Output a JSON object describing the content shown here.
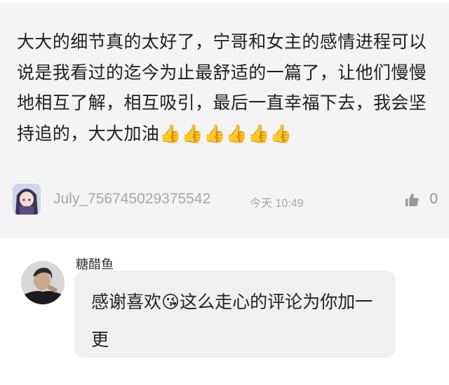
{
  "comment": {
    "text": "大大的细节真的太好了，宁哥和女主的感情进程可以说是我看过的迄今为止最舒适的一篇了，让他们慢慢地相互了解，相互吸引，最后一直幸福下去，我会坚持追的，大大加油",
    "emojis": "👍👍👍👍👍👍",
    "username": "July_756745029375542",
    "time": "今天 10:49",
    "like_count": "0",
    "avatar_icon": "anime-avatar-icon",
    "like_icon": "thumbs-up-icon"
  },
  "reply": {
    "author": "糖醋鱼",
    "text": "感谢喜欢",
    "emoji": "😘",
    "text_rest": "这么走心的评论为你加一更",
    "avatar_icon": "person-avatar-icon"
  }
}
